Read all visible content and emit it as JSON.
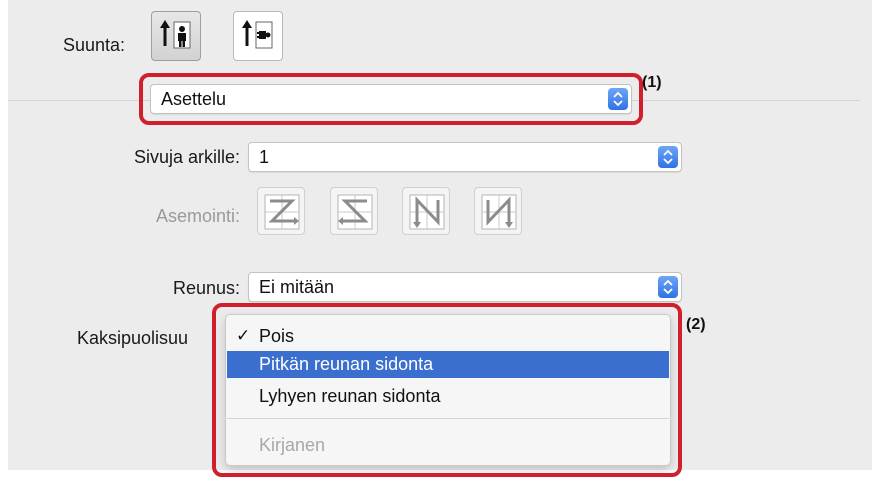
{
  "orientation": {
    "label": "Suunta:",
    "options": [
      {
        "name": "portrait",
        "selected": true
      },
      {
        "name": "landscape",
        "selected": false
      }
    ]
  },
  "section_popup": {
    "value": "Asettelu"
  },
  "pages_per_sheet": {
    "label": "Sivuja arkille:",
    "value": "1"
  },
  "layout_direction": {
    "label": "Asemointi:",
    "enabled": false,
    "options": [
      "z-order",
      "reverse-z-order",
      "reverse-n-order",
      "n-order"
    ]
  },
  "border": {
    "label": "Reunus:",
    "value": "Ei mitään"
  },
  "two_sided": {
    "label": "Kaksipuolisuu",
    "menu": {
      "items": [
        {
          "label": "Pois",
          "checked": true,
          "highlighted": false,
          "enabled": true
        },
        {
          "label": "Pitkän reunan sidonta",
          "checked": false,
          "highlighted": true,
          "enabled": true
        },
        {
          "label": "Lyhyen reunan sidonta",
          "checked": false,
          "highlighted": false,
          "enabled": true
        },
        {
          "label": "Kirjanen",
          "checked": false,
          "highlighted": false,
          "enabled": false
        }
      ],
      "check_glyph": "✓"
    }
  },
  "annotations": {
    "callout_1": "(1)",
    "callout_2": "(2)"
  },
  "colors": {
    "highlight_box": "#d0202c",
    "menu_selection": "#3a6fd0",
    "stepper": "#2f72e6"
  }
}
